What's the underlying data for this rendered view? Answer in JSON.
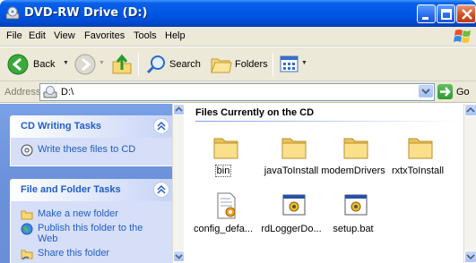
{
  "window": {
    "title": "DVD-RW Drive (D:)"
  },
  "menu": {
    "items": [
      "File",
      "Edit",
      "View",
      "Favorites",
      "Tools",
      "Help"
    ]
  },
  "toolbar": {
    "back_label": "Back",
    "search_label": "Search",
    "folders_label": "Folders"
  },
  "address": {
    "label": "Address",
    "value": "D:\\",
    "go_label": "Go"
  },
  "tasks": {
    "cd_writing": {
      "title": "CD Writing Tasks",
      "items": [
        {
          "label": "Write these files to CD",
          "icon": "cd-write-icon"
        }
      ]
    },
    "file_folder": {
      "title": "File and Folder Tasks",
      "items": [
        {
          "label": "Make a new folder",
          "icon": "new-folder-icon"
        },
        {
          "label": "Publish this folder to the Web",
          "icon": "web-publish-icon"
        },
        {
          "label": "Share this folder",
          "icon": "share-folder-icon"
        }
      ]
    }
  },
  "content": {
    "group_title": "Files Currently on the CD",
    "files": [
      {
        "name": "bin",
        "type": "folder",
        "selected": true
      },
      {
        "name": "javaToInstall",
        "type": "folder"
      },
      {
        "name": "modemDrivers",
        "type": "folder"
      },
      {
        "name": "rxtxToInstall",
        "type": "folder"
      },
      {
        "name": "config_defa...",
        "type": "config"
      },
      {
        "name": "rdLoggerDo...",
        "type": "batch"
      },
      {
        "name": "setup.bat",
        "type": "batch"
      }
    ]
  },
  "colors": {
    "titlebar": "#0058e6",
    "taskpane": "#6b91da",
    "link": "#215dc6",
    "folder": "#f8d775"
  }
}
